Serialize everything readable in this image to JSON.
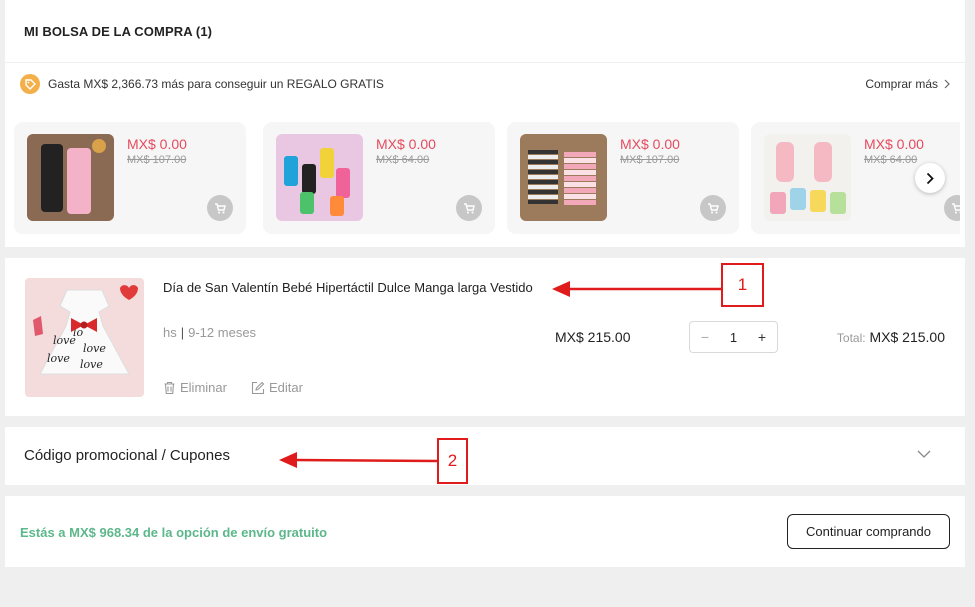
{
  "cart": {
    "title": "MI BOLSA DE LA COMPRA (1)",
    "gift_banner": "Gasta MX$ 2,366.73 más para conseguir un REGALO GRATIS",
    "buy_more": "Comprar más",
    "gift_cards": [
      {
        "price": "MX$ 0.00",
        "old_price": "MX$ 107.00",
        "image": "black-pink-leggings"
      },
      {
        "price": "MX$ 0.00",
        "old_price": "MX$ 64.00",
        "image": "kids-watches"
      },
      {
        "price": "MX$ 0.00",
        "old_price": "MX$ 107.00",
        "image": "striped-pink-pants"
      },
      {
        "price": "MX$ 0.00",
        "old_price": "MX$ 64.00",
        "image": "knee-socks"
      }
    ]
  },
  "item": {
    "title": "Día de San Valentín Bebé Hipertáctil Dulce Manga larga Vestido",
    "variant_color": "hs",
    "variant_size": "9-12 meses",
    "delete_label": "Eliminar",
    "edit_label": "Editar",
    "unit_price": "MX$ 215.00",
    "quantity": "1",
    "qty_minus": "−",
    "qty_plus": "+",
    "total_label": "Total:",
    "total_value": "MX$ 215.00"
  },
  "promo": {
    "label": "Código promocional / Cupones"
  },
  "shipping": {
    "text": "Estás a MX$ 968.34 de la opción de envío gratuito",
    "continue_label": "Continuar comprando"
  },
  "annotations": {
    "callout_1": "1",
    "callout_2": "2"
  },
  "colors": {
    "sale_price": "#e54b5e",
    "shipping_green": "#5cb78a",
    "annotation_red": "#e01b1b",
    "gift_icon": "#f3b04a"
  }
}
